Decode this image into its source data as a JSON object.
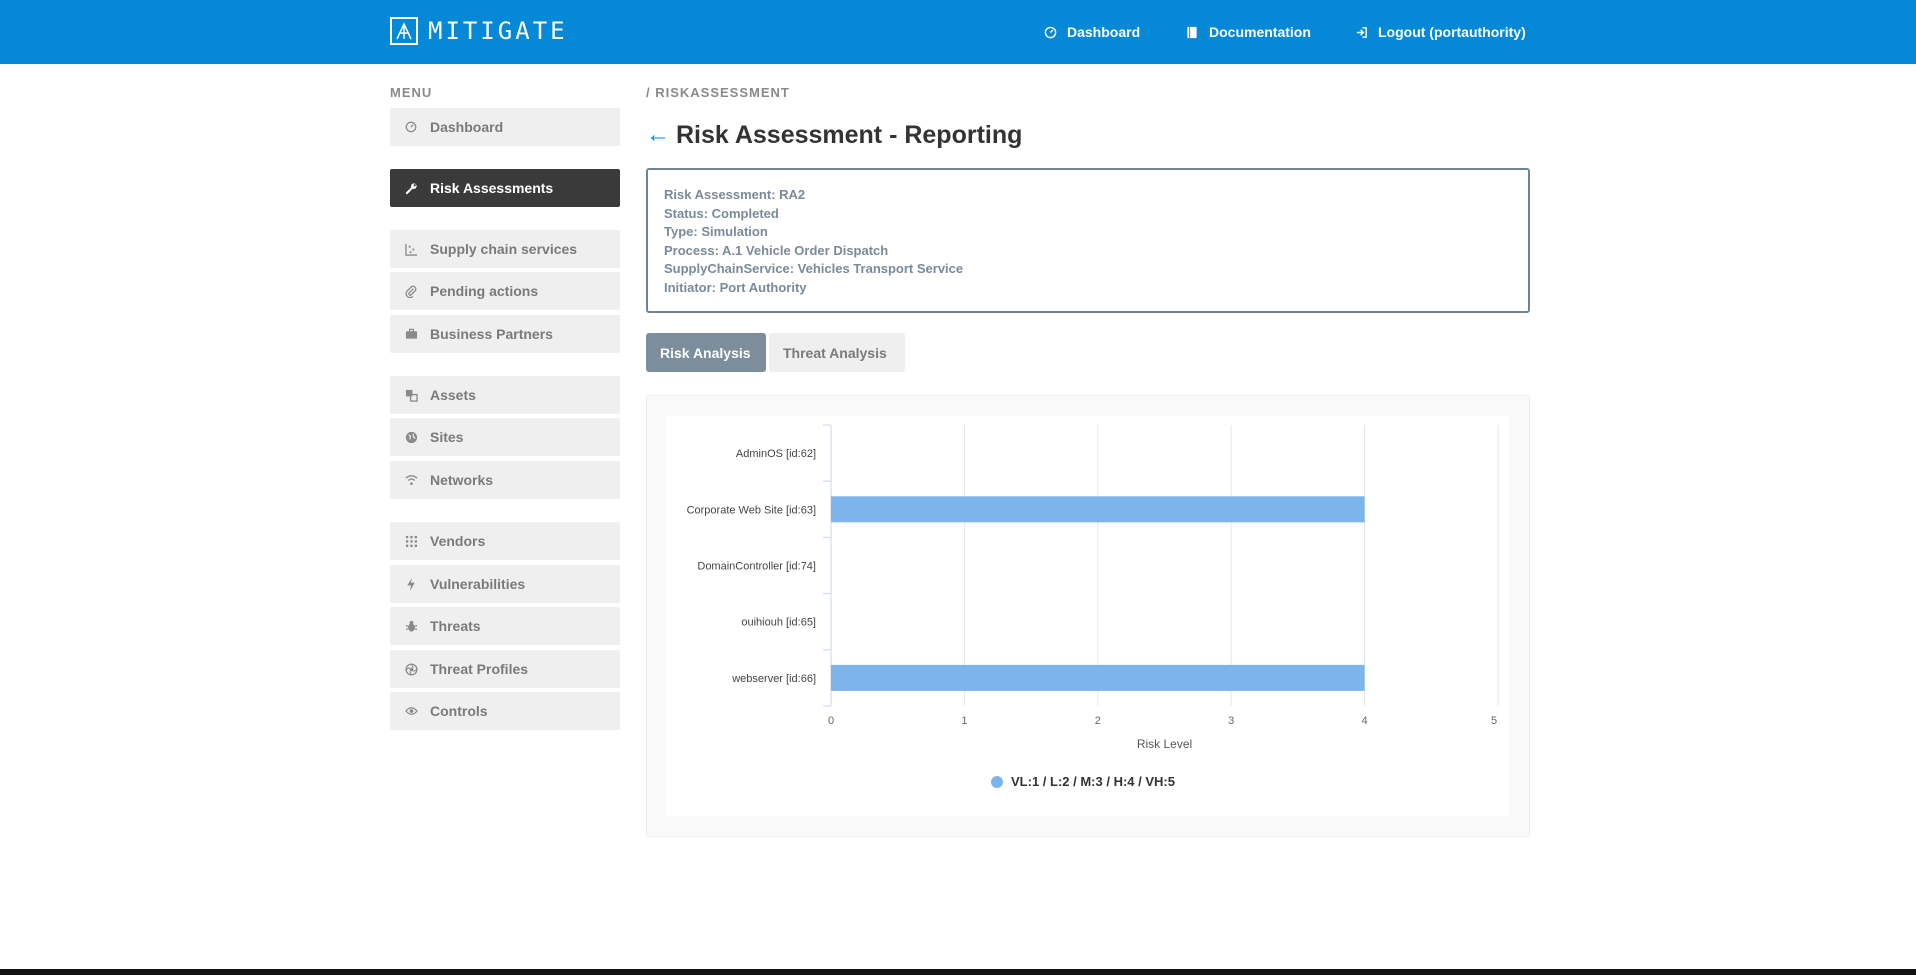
{
  "brand": {
    "name": "MITIGATE"
  },
  "topnav": {
    "dashboard": "Dashboard",
    "documentation": "Documentation",
    "logout": "Logout (portauthority)"
  },
  "sidebar": {
    "heading": "MENU",
    "items": [
      {
        "label": "Dashboard",
        "icon": "dashboard-icon"
      },
      {
        "label": "Risk Assessments",
        "icon": "wrench-icon",
        "active": true
      },
      {
        "label": "Supply chain services",
        "icon": "supply-chain-icon"
      },
      {
        "label": "Pending actions",
        "icon": "paperclip-icon"
      },
      {
        "label": "Business Partners",
        "icon": "briefcase-icon"
      },
      {
        "label": "Assets",
        "icon": "assets-icon"
      },
      {
        "label": "Sites",
        "icon": "globe-icon"
      },
      {
        "label": "Networks",
        "icon": "wifi-icon"
      },
      {
        "label": "Vendors",
        "icon": "grid-icon"
      },
      {
        "label": "Vulnerabilities",
        "icon": "bolt-icon"
      },
      {
        "label": "Threats",
        "icon": "bug-icon"
      },
      {
        "label": "Threat Profiles",
        "icon": "aperture-icon"
      },
      {
        "label": "Controls",
        "icon": "eye-icon"
      }
    ]
  },
  "breadcrumb": "/ RISKASSESSMENT",
  "page": {
    "title": "Risk Assessment - Reporting"
  },
  "info": {
    "lines": [
      "Risk Assessment: RA2",
      "Status: Completed",
      "Type: Simulation",
      "Process: A.1 Vehicle Order Dispatch",
      "SupplyChainService: Vehicles Transport Service",
      "Initiator: Port Authority"
    ]
  },
  "tabs": {
    "risk": "Risk Analysis",
    "threat": "Threat Analysis"
  },
  "colors": {
    "accent": "#0589d6",
    "bar": "#7cb4ec",
    "active_tab": "#7c8e9c",
    "active_menu": "#3a3a3a"
  },
  "chart_data": {
    "type": "bar",
    "orientation": "horizontal",
    "categories": [
      "AdminOS [id:62]",
      "Corporate Web Site [id:63]",
      "DomainController [id:74]",
      "ouihiouh [id:65]",
      "webserver [id:66]"
    ],
    "series": [
      {
        "name": "VL:1 / L:2 / M:3 / H:4 / VH:5",
        "values": [
          0,
          4,
          0,
          0,
          4
        ]
      }
    ],
    "xlabel": "Risk Level",
    "xlim": [
      0,
      5
    ],
    "xticks": [
      "0",
      "1",
      "2",
      "3",
      "4",
      "5"
    ],
    "grid": true,
    "legend": "bottom-center"
  }
}
